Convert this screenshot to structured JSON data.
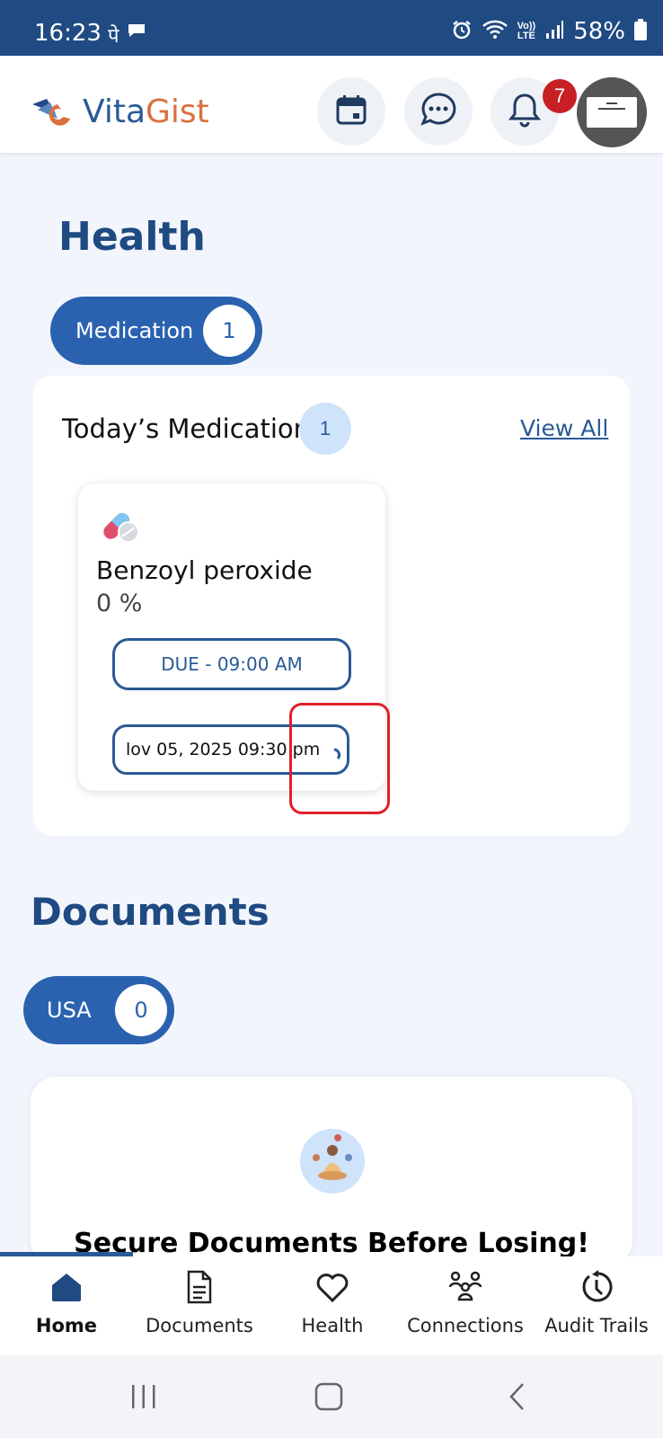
{
  "status_bar": {
    "time": "16:23",
    "left_icons": [
      "phonepe-icon",
      "chat-bubble-icon"
    ],
    "right_icons": [
      "alarm-icon",
      "wifi-icon",
      "lte-icon",
      "signal-icon"
    ],
    "lte_top": "Vo))",
    "lte_bottom": "LTE",
    "battery": "58%"
  },
  "header": {
    "logo_vita": "Vita",
    "logo_gist": "Gist",
    "notification_count": "7",
    "actions": [
      "calendar-icon",
      "chat-icon",
      "bell-icon"
    ]
  },
  "health": {
    "title": "Health",
    "filter_label": "Medication",
    "filter_count": "1",
    "today_label": "Today’s Medications",
    "today_count": "1",
    "view_all": "View All",
    "medication": {
      "name": "Benzoyl peroxide",
      "dose": "0 %",
      "due": "DUE - 09:00 AM",
      "datetime": "lov 05, 2025 09:30 pm"
    }
  },
  "documents": {
    "title": "Documents",
    "filter_label": "USA",
    "filter_count": "0",
    "headline": "Secure Documents Before Losing!"
  },
  "bottom_nav": [
    {
      "label": "Home",
      "icon": "home-icon",
      "active": true
    },
    {
      "label": "Documents",
      "icon": "document-icon",
      "active": false
    },
    {
      "label": "Health",
      "icon": "heart-icon",
      "active": false
    },
    {
      "label": "Connections",
      "icon": "connections-icon",
      "active": false
    },
    {
      "label": "Audit Trails",
      "icon": "history-icon",
      "active": false
    }
  ],
  "colors": {
    "brand_dark": "#1f4a82",
    "brand": "#2a62b0",
    "accent_orange": "#d9713f",
    "badge_red": "#c71f24",
    "highlight_red": "#e0212b",
    "background": "#f2f6fc"
  }
}
